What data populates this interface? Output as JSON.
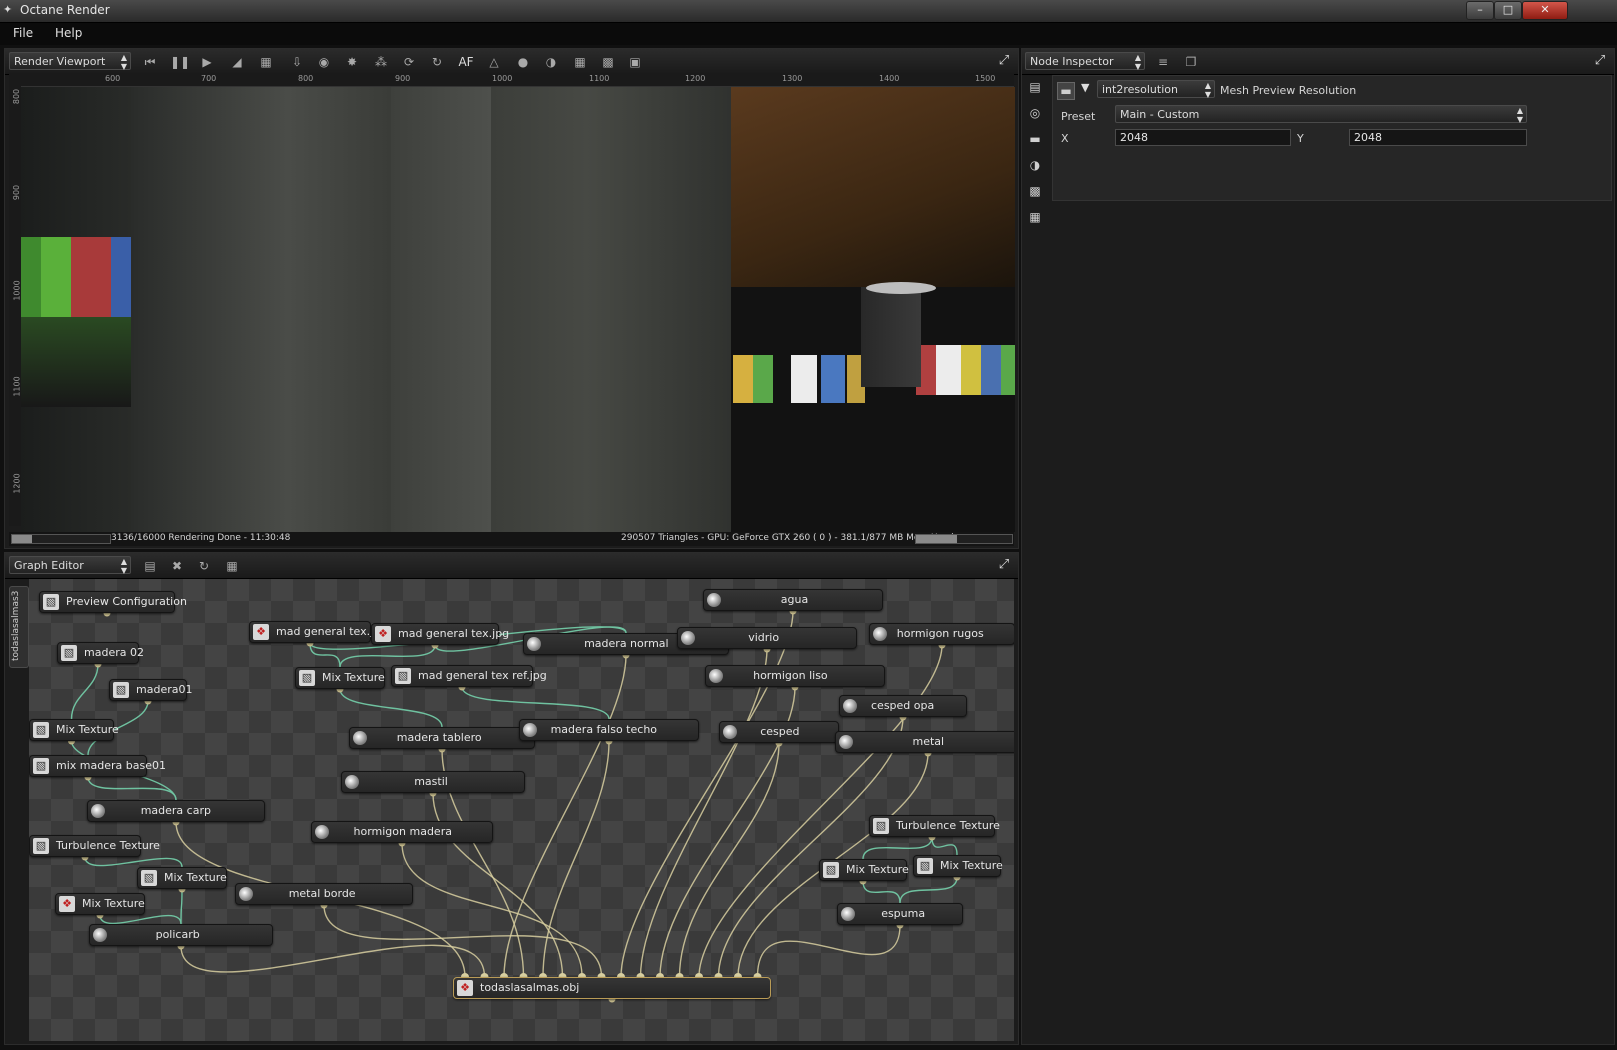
{
  "window": {
    "title": "Octane Render",
    "min_glyph": "–",
    "max_glyph": "□",
    "close_glyph": "✕"
  },
  "menu": {
    "items": [
      "File",
      "Help"
    ]
  },
  "viewport": {
    "combo_label": "Render Viewport",
    "af_label": "AF",
    "ruler_top": [
      "600",
      "700",
      "800",
      "900",
      "1000",
      "1100",
      "1200",
      "1300",
      "1400",
      "1500"
    ],
    "ruler_left": [
      "800",
      "900",
      "1000",
      "1100",
      "1200"
    ],
    "status_left": "3136/16000 Rendering Done - 11:30:48",
    "status_right": "290507 Triangles - GPU: GeForce GTX 260 ( 0 ) - 381.1/877 MB Mem Used",
    "render_progress": 0.2,
    "mem_progress": 0.43
  },
  "graph": {
    "combo_label": "Graph Editor",
    "tab_label": "todaslasalmas3",
    "nodes": [
      {
        "label": "Preview Configuration",
        "icon": "tex"
      },
      {
        "label": "madera 02",
        "icon": "tex"
      },
      {
        "label": "madera01",
        "icon": "tex"
      },
      {
        "label": "Mix Texture",
        "icon": "tex"
      },
      {
        "label": "mix madera base01",
        "icon": "tex"
      },
      {
        "label": "madera carp",
        "icon": "mat"
      },
      {
        "label": "Turbulence Texture",
        "icon": "tex"
      },
      {
        "label": "Mix Texture",
        "icon": "tex"
      },
      {
        "label": "Mix Texture",
        "icon": "img"
      },
      {
        "label": "policarb",
        "icon": "mat"
      },
      {
        "label": "mad general tex.jpg",
        "icon": "img"
      },
      {
        "label": "mad general tex.jpg",
        "icon": "img"
      },
      {
        "label": "Mix Texture",
        "icon": "tex"
      },
      {
        "label": "mad general tex ref.jpg",
        "icon": "tex"
      },
      {
        "label": "madera normal",
        "icon": "mat"
      },
      {
        "label": "madera tablero",
        "icon": "mat"
      },
      {
        "label": "madera falso techo",
        "icon": "mat"
      },
      {
        "label": "mastil",
        "icon": "mat"
      },
      {
        "label": "hormigon madera",
        "icon": "mat"
      },
      {
        "label": "metal borde",
        "icon": "mat"
      },
      {
        "label": "agua",
        "icon": "mat"
      },
      {
        "label": "vidrio",
        "icon": "mat"
      },
      {
        "label": "hormigon liso",
        "icon": "mat"
      },
      {
        "label": "cesped",
        "icon": "mat"
      },
      {
        "label": "hormigon rugos",
        "icon": "mat"
      },
      {
        "label": "cesped opa",
        "icon": "mat"
      },
      {
        "label": "metal",
        "icon": "mat"
      },
      {
        "label": "Turbulence Texture",
        "icon": "tex"
      },
      {
        "label": "Mix Texture",
        "icon": "tex"
      },
      {
        "label": "Mix Texture",
        "icon": "tex"
      },
      {
        "label": "espuma",
        "icon": "mat"
      },
      {
        "label": "todaslasalmas.obj",
        "icon": "img"
      }
    ]
  },
  "inspector": {
    "combo_label": "Node Inspector",
    "node_combo": "int2resolution",
    "node_title": "Mesh Preview Resolution",
    "preset_label": "Preset",
    "preset_value": "Main - Custom",
    "x_label": "X",
    "x_value": "2048",
    "y_label": "Y",
    "y_value": "2048"
  },
  "colors": {
    "accent_mesh_border": "#b99b56",
    "wire": "#d8cfa0",
    "pin_green": "#6fc2a0",
    "pin_purple": "#b07ad0",
    "pin_blue": "#7c95d8"
  }
}
